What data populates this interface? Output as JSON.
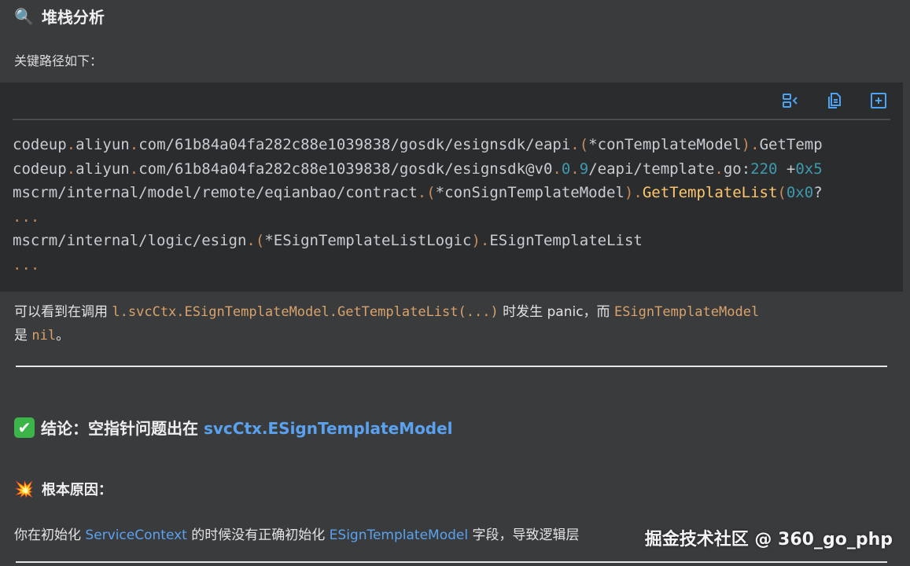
{
  "heading1": {
    "icon": "magnifier-icon",
    "emoji": "🔍",
    "text": "堆栈分析"
  },
  "para1": "关键路径如下：",
  "code_block": {
    "toolbar_icons": [
      "wrap-lines-icon",
      "copy-icon",
      "expand-icon"
    ],
    "lines": [
      [
        [
          "c-plain",
          "codeup"
        ],
        [
          "c-punc",
          "."
        ],
        [
          "c-plain",
          "aliyun"
        ],
        [
          "c-punc",
          "."
        ],
        [
          "c-plain",
          "com/61b84a04fa282c88e1039838/gosdk/esignsdk/eapi"
        ],
        [
          "c-punc",
          "."
        ],
        [
          "c-punc",
          "("
        ],
        [
          "c-op",
          "*"
        ],
        [
          "c-plain",
          "conTemplateModel"
        ],
        [
          "c-punc",
          ")"
        ],
        [
          "c-punc",
          "."
        ],
        [
          "c-plain",
          "GetTemp"
        ]
      ],
      [
        [
          "c-plain",
          "codeup"
        ],
        [
          "c-punc",
          "."
        ],
        [
          "c-plain",
          "aliyun"
        ],
        [
          "c-punc",
          "."
        ],
        [
          "c-plain",
          "com/61b84a04fa282c88e1039838/gosdk/esignsdk@v0"
        ],
        [
          "c-punc",
          "."
        ],
        [
          "c-num",
          "0"
        ],
        [
          "c-punc",
          "."
        ],
        [
          "c-num",
          "9"
        ],
        [
          "c-plain",
          "/eapi/template"
        ],
        [
          "c-punc",
          "."
        ],
        [
          "c-plain",
          "go:"
        ],
        [
          "c-num",
          "220"
        ],
        [
          "c-plain",
          " +"
        ],
        [
          "c-num",
          "0x5"
        ]
      ],
      [
        [
          "c-plain",
          "mscrm/internal/model/remote/eqianbao/contract"
        ],
        [
          "c-punc",
          "."
        ],
        [
          "c-punc",
          "("
        ],
        [
          "c-op",
          "*"
        ],
        [
          "c-plain",
          "conSignTemplateModel"
        ],
        [
          "c-punc",
          ")"
        ],
        [
          "c-punc",
          "."
        ],
        [
          "c-fn",
          "GetTemplateList"
        ],
        [
          "c-punc",
          "("
        ],
        [
          "c-num",
          "0x0"
        ],
        [
          "c-plain",
          "?"
        ]
      ],
      [
        [
          "c-punc",
          "..."
        ]
      ],
      [
        [
          "c-plain",
          "mscrm/internal/logic/esign"
        ],
        [
          "c-punc",
          "."
        ],
        [
          "c-punc",
          "("
        ],
        [
          "c-op",
          "*"
        ],
        [
          "c-plain",
          "ESignTemplateListLogic"
        ],
        [
          "c-punc",
          ")"
        ],
        [
          "c-punc",
          "."
        ],
        [
          "c-plain",
          "ESignTemplateList"
        ]
      ],
      [
        [
          "c-punc",
          "..."
        ]
      ]
    ]
  },
  "para2": {
    "t1": "可以看到在调用 ",
    "code1": "l.svcCtx.ESignTemplateModel.GetTemplateList(...)",
    "t2": " 时发生 panic，而 ",
    "code2": "ESignTemplateModel",
    "t3": "是 ",
    "code3": "nil",
    "t4": "。"
  },
  "heading2": {
    "icon": "check-mark-icon",
    "emoji": "✔",
    "text": "结论：空指针问题出在 ",
    "highlight": "svcCtx.ESignTemplateModel"
  },
  "heading3": {
    "icon": "collision-icon",
    "emoji": "💥",
    "text": "根本原因："
  },
  "para3": {
    "t1": "你在初始化 ",
    "hl1": "ServiceContext",
    "t2": " 的时候没有正确初始化 ",
    "hl2": "ESignTemplateModel",
    "t3": " 字段，导致逻辑层"
  },
  "watermark": "掘金技术社区 @ 360_go_php"
}
